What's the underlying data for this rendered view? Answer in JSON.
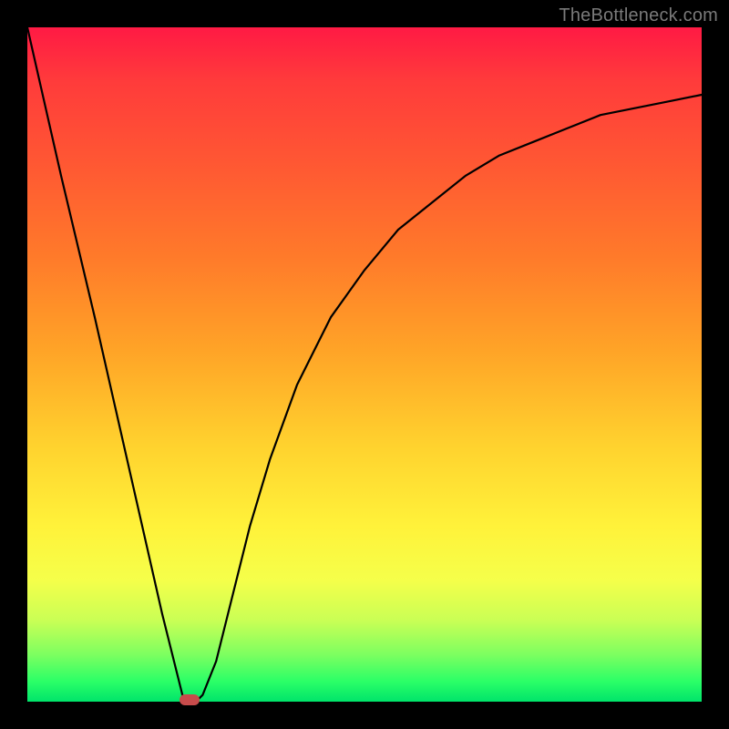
{
  "watermark": "TheBottleneck.com",
  "chart_data": {
    "type": "line",
    "title": "",
    "xlabel": "",
    "ylabel": "",
    "xlim": [
      0,
      100
    ],
    "ylim": [
      0,
      100
    ],
    "grid": false,
    "series": [
      {
        "name": "curve",
        "x": [
          0,
          5,
          10,
          15,
          20,
          23,
          24,
          25,
          26,
          28,
          30,
          33,
          36,
          40,
          45,
          50,
          55,
          60,
          65,
          70,
          75,
          80,
          85,
          90,
          95,
          100
        ],
        "y": [
          100,
          78,
          57,
          35,
          13,
          1,
          0,
          0,
          1,
          6,
          14,
          26,
          36,
          47,
          57,
          64,
          70,
          74,
          78,
          81,
          83,
          85,
          87,
          88,
          89,
          90
        ]
      }
    ],
    "annotations": [
      {
        "name": "min-marker",
        "x": 24,
        "y": 0,
        "shape": "rounded-rect",
        "color": "#c74b4b"
      }
    ],
    "background_gradient": {
      "direction": "top-to-bottom",
      "stops": [
        {
          "pos": 0,
          "color": "#ff1a44"
        },
        {
          "pos": 50,
          "color": "#ffb62e"
        },
        {
          "pos": 80,
          "color": "#fff23a"
        },
        {
          "pos": 100,
          "color": "#00e46a"
        }
      ]
    }
  }
}
